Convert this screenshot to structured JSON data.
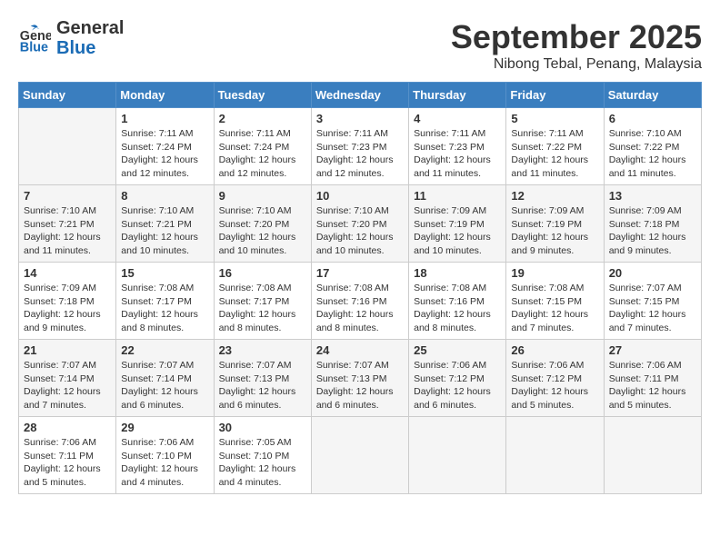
{
  "app": {
    "logo_line1": "General",
    "logo_line2": "Blue"
  },
  "title": "September 2025",
  "subtitle": "Nibong Tebal, Penang, Malaysia",
  "days_of_week": [
    "Sunday",
    "Monday",
    "Tuesday",
    "Wednesday",
    "Thursday",
    "Friday",
    "Saturday"
  ],
  "weeks": [
    [
      {
        "num": "",
        "info": ""
      },
      {
        "num": "1",
        "info": "Sunrise: 7:11 AM\nSunset: 7:24 PM\nDaylight: 12 hours\nand 12 minutes."
      },
      {
        "num": "2",
        "info": "Sunrise: 7:11 AM\nSunset: 7:24 PM\nDaylight: 12 hours\nand 12 minutes."
      },
      {
        "num": "3",
        "info": "Sunrise: 7:11 AM\nSunset: 7:23 PM\nDaylight: 12 hours\nand 12 minutes."
      },
      {
        "num": "4",
        "info": "Sunrise: 7:11 AM\nSunset: 7:23 PM\nDaylight: 12 hours\nand 11 minutes."
      },
      {
        "num": "5",
        "info": "Sunrise: 7:11 AM\nSunset: 7:22 PM\nDaylight: 12 hours\nand 11 minutes."
      },
      {
        "num": "6",
        "info": "Sunrise: 7:10 AM\nSunset: 7:22 PM\nDaylight: 12 hours\nand 11 minutes."
      }
    ],
    [
      {
        "num": "7",
        "info": "Sunrise: 7:10 AM\nSunset: 7:21 PM\nDaylight: 12 hours\nand 11 minutes."
      },
      {
        "num": "8",
        "info": "Sunrise: 7:10 AM\nSunset: 7:21 PM\nDaylight: 12 hours\nand 10 minutes."
      },
      {
        "num": "9",
        "info": "Sunrise: 7:10 AM\nSunset: 7:20 PM\nDaylight: 12 hours\nand 10 minutes."
      },
      {
        "num": "10",
        "info": "Sunrise: 7:10 AM\nSunset: 7:20 PM\nDaylight: 12 hours\nand 10 minutes."
      },
      {
        "num": "11",
        "info": "Sunrise: 7:09 AM\nSunset: 7:19 PM\nDaylight: 12 hours\nand 10 minutes."
      },
      {
        "num": "12",
        "info": "Sunrise: 7:09 AM\nSunset: 7:19 PM\nDaylight: 12 hours\nand 9 minutes."
      },
      {
        "num": "13",
        "info": "Sunrise: 7:09 AM\nSunset: 7:18 PM\nDaylight: 12 hours\nand 9 minutes."
      }
    ],
    [
      {
        "num": "14",
        "info": "Sunrise: 7:09 AM\nSunset: 7:18 PM\nDaylight: 12 hours\nand 9 minutes."
      },
      {
        "num": "15",
        "info": "Sunrise: 7:08 AM\nSunset: 7:17 PM\nDaylight: 12 hours\nand 8 minutes."
      },
      {
        "num": "16",
        "info": "Sunrise: 7:08 AM\nSunset: 7:17 PM\nDaylight: 12 hours\nand 8 minutes."
      },
      {
        "num": "17",
        "info": "Sunrise: 7:08 AM\nSunset: 7:16 PM\nDaylight: 12 hours\nand 8 minutes."
      },
      {
        "num": "18",
        "info": "Sunrise: 7:08 AM\nSunset: 7:16 PM\nDaylight: 12 hours\nand 8 minutes."
      },
      {
        "num": "19",
        "info": "Sunrise: 7:08 AM\nSunset: 7:15 PM\nDaylight: 12 hours\nand 7 minutes."
      },
      {
        "num": "20",
        "info": "Sunrise: 7:07 AM\nSunset: 7:15 PM\nDaylight: 12 hours\nand 7 minutes."
      }
    ],
    [
      {
        "num": "21",
        "info": "Sunrise: 7:07 AM\nSunset: 7:14 PM\nDaylight: 12 hours\nand 7 minutes."
      },
      {
        "num": "22",
        "info": "Sunrise: 7:07 AM\nSunset: 7:14 PM\nDaylight: 12 hours\nand 6 minutes."
      },
      {
        "num": "23",
        "info": "Sunrise: 7:07 AM\nSunset: 7:13 PM\nDaylight: 12 hours\nand 6 minutes."
      },
      {
        "num": "24",
        "info": "Sunrise: 7:07 AM\nSunset: 7:13 PM\nDaylight: 12 hours\nand 6 minutes."
      },
      {
        "num": "25",
        "info": "Sunrise: 7:06 AM\nSunset: 7:12 PM\nDaylight: 12 hours\nand 6 minutes."
      },
      {
        "num": "26",
        "info": "Sunrise: 7:06 AM\nSunset: 7:12 PM\nDaylight: 12 hours\nand 5 minutes."
      },
      {
        "num": "27",
        "info": "Sunrise: 7:06 AM\nSunset: 7:11 PM\nDaylight: 12 hours\nand 5 minutes."
      }
    ],
    [
      {
        "num": "28",
        "info": "Sunrise: 7:06 AM\nSunset: 7:11 PM\nDaylight: 12 hours\nand 5 minutes."
      },
      {
        "num": "29",
        "info": "Sunrise: 7:06 AM\nSunset: 7:10 PM\nDaylight: 12 hours\nand 4 minutes."
      },
      {
        "num": "30",
        "info": "Sunrise: 7:05 AM\nSunset: 7:10 PM\nDaylight: 12 hours\nand 4 minutes."
      },
      {
        "num": "",
        "info": ""
      },
      {
        "num": "",
        "info": ""
      },
      {
        "num": "",
        "info": ""
      },
      {
        "num": "",
        "info": ""
      }
    ]
  ]
}
